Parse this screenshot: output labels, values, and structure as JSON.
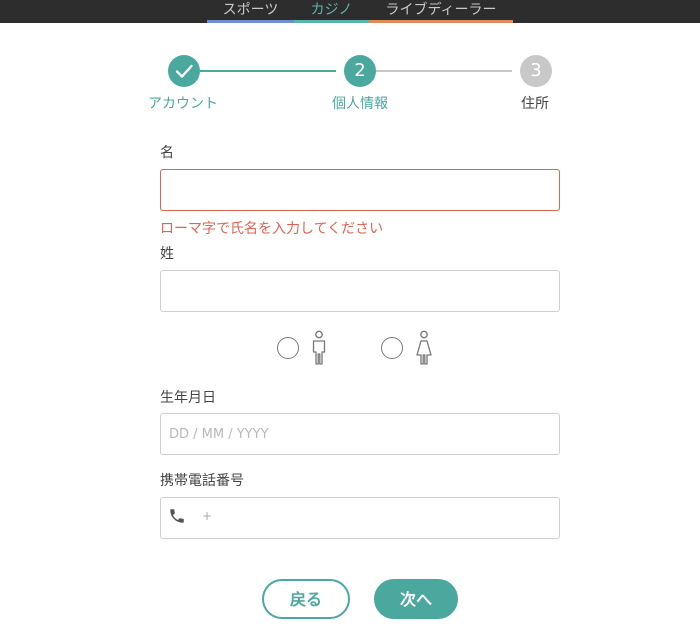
{
  "topnav": {
    "tabs": [
      {
        "label": "スポーツ",
        "underline": "#6f8fcf"
      },
      {
        "label": "カジノ",
        "underline": "#5ab4ad"
      },
      {
        "label": "ライブディーラー",
        "underline": "#e08a5a"
      }
    ]
  },
  "stepper": {
    "steps": [
      {
        "label": "アカウント",
        "state": "done",
        "icon": "check-icon"
      },
      {
        "number": "2",
        "label": "個人情報",
        "state": "active"
      },
      {
        "number": "3",
        "label": "住所",
        "state": "upcoming"
      }
    ]
  },
  "form": {
    "first_name_label": "名",
    "first_name_error": "ローマ字で氏名を入力してください",
    "last_name_label": "姓",
    "birthdate_label": "生年月日",
    "birthdate_placeholder": "DD / MM / YYYY",
    "phone_label": "携帯電話番号",
    "phone_prefix": "+"
  },
  "buttons": {
    "back": "戻る",
    "next": "次へ"
  },
  "colors": {
    "accent": "#4aa89f",
    "error": "#de6451",
    "inactive": "#c8c8c8"
  }
}
